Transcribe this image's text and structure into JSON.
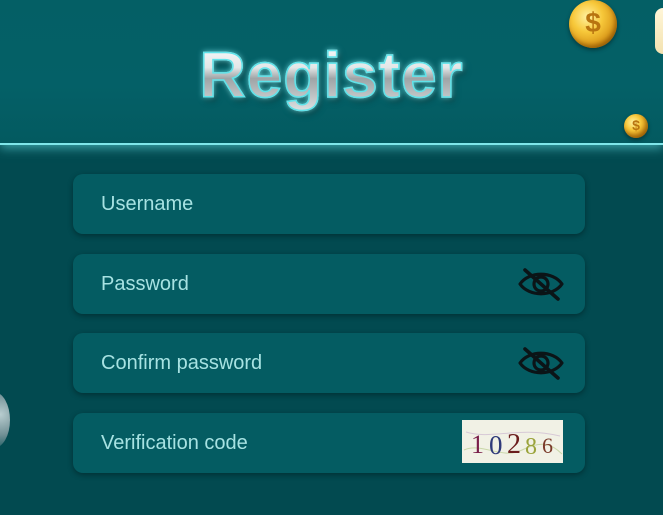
{
  "header": {
    "title": "Register"
  },
  "form": {
    "username_placeholder": "Username",
    "password_placeholder": "Password",
    "confirm_password_placeholder": "Confirm password",
    "verification_placeholder": "Verification code",
    "captcha_digits": [
      "1",
      "0",
      "2",
      "8",
      "6"
    ]
  },
  "icons": {
    "password_toggle": "eye-slash-icon",
    "confirm_toggle": "eye-slash-icon"
  },
  "colors": {
    "background": "#024a50",
    "header": "#046067",
    "field": "#045c62",
    "placeholder": "#a7e2e2",
    "title_outline": "#5fe3ea"
  }
}
